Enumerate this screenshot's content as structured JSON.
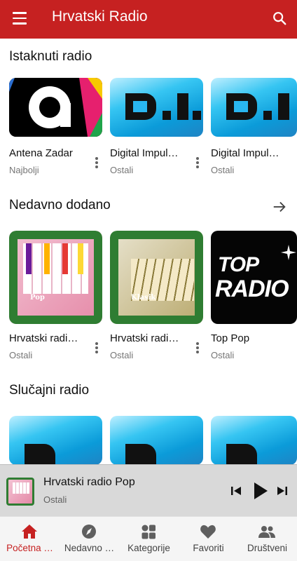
{
  "app": {
    "title": "Hrvatski Radio",
    "accent": "#c62121"
  },
  "icons": {
    "menu": "menu-icon",
    "search": "search-icon",
    "more": "more-vert-icon",
    "arrow": "arrow-right-icon"
  },
  "sections": {
    "featured": {
      "title": "Istaknuti radio",
      "items": [
        {
          "name": "Antena Zadar",
          "category": "Najbolji"
        },
        {
          "name": "Digital Impul…",
          "category": "Ostali"
        },
        {
          "name": "Digital Impul…",
          "category": "Ostali"
        }
      ]
    },
    "recent": {
      "title": "Nedavno dodano",
      "items": [
        {
          "name": "Hrvatski radi…",
          "category": "Ostali",
          "tag": "Pop"
        },
        {
          "name": "Hrvatski radi…",
          "category": "Ostali",
          "tag": "Klasik"
        },
        {
          "name": "Top Pop",
          "category": "Ostali",
          "logo_line1": "TOP",
          "logo_line2": "RADIO"
        }
      ]
    },
    "random": {
      "title": "Slučajni radio"
    }
  },
  "player": {
    "title": "Hrvatski radio Pop",
    "subtitle": "Ostali"
  },
  "bottom_nav": [
    {
      "label": "Početna …",
      "icon": "home-icon",
      "active": true
    },
    {
      "label": "Nedavno …",
      "icon": "compass-icon",
      "active": false
    },
    {
      "label": "Kategorije",
      "icon": "grid-icon",
      "active": false
    },
    {
      "label": "Favoriti",
      "icon": "heart-icon",
      "active": false
    },
    {
      "label": "Društveni",
      "icon": "people-icon",
      "active": false
    }
  ]
}
